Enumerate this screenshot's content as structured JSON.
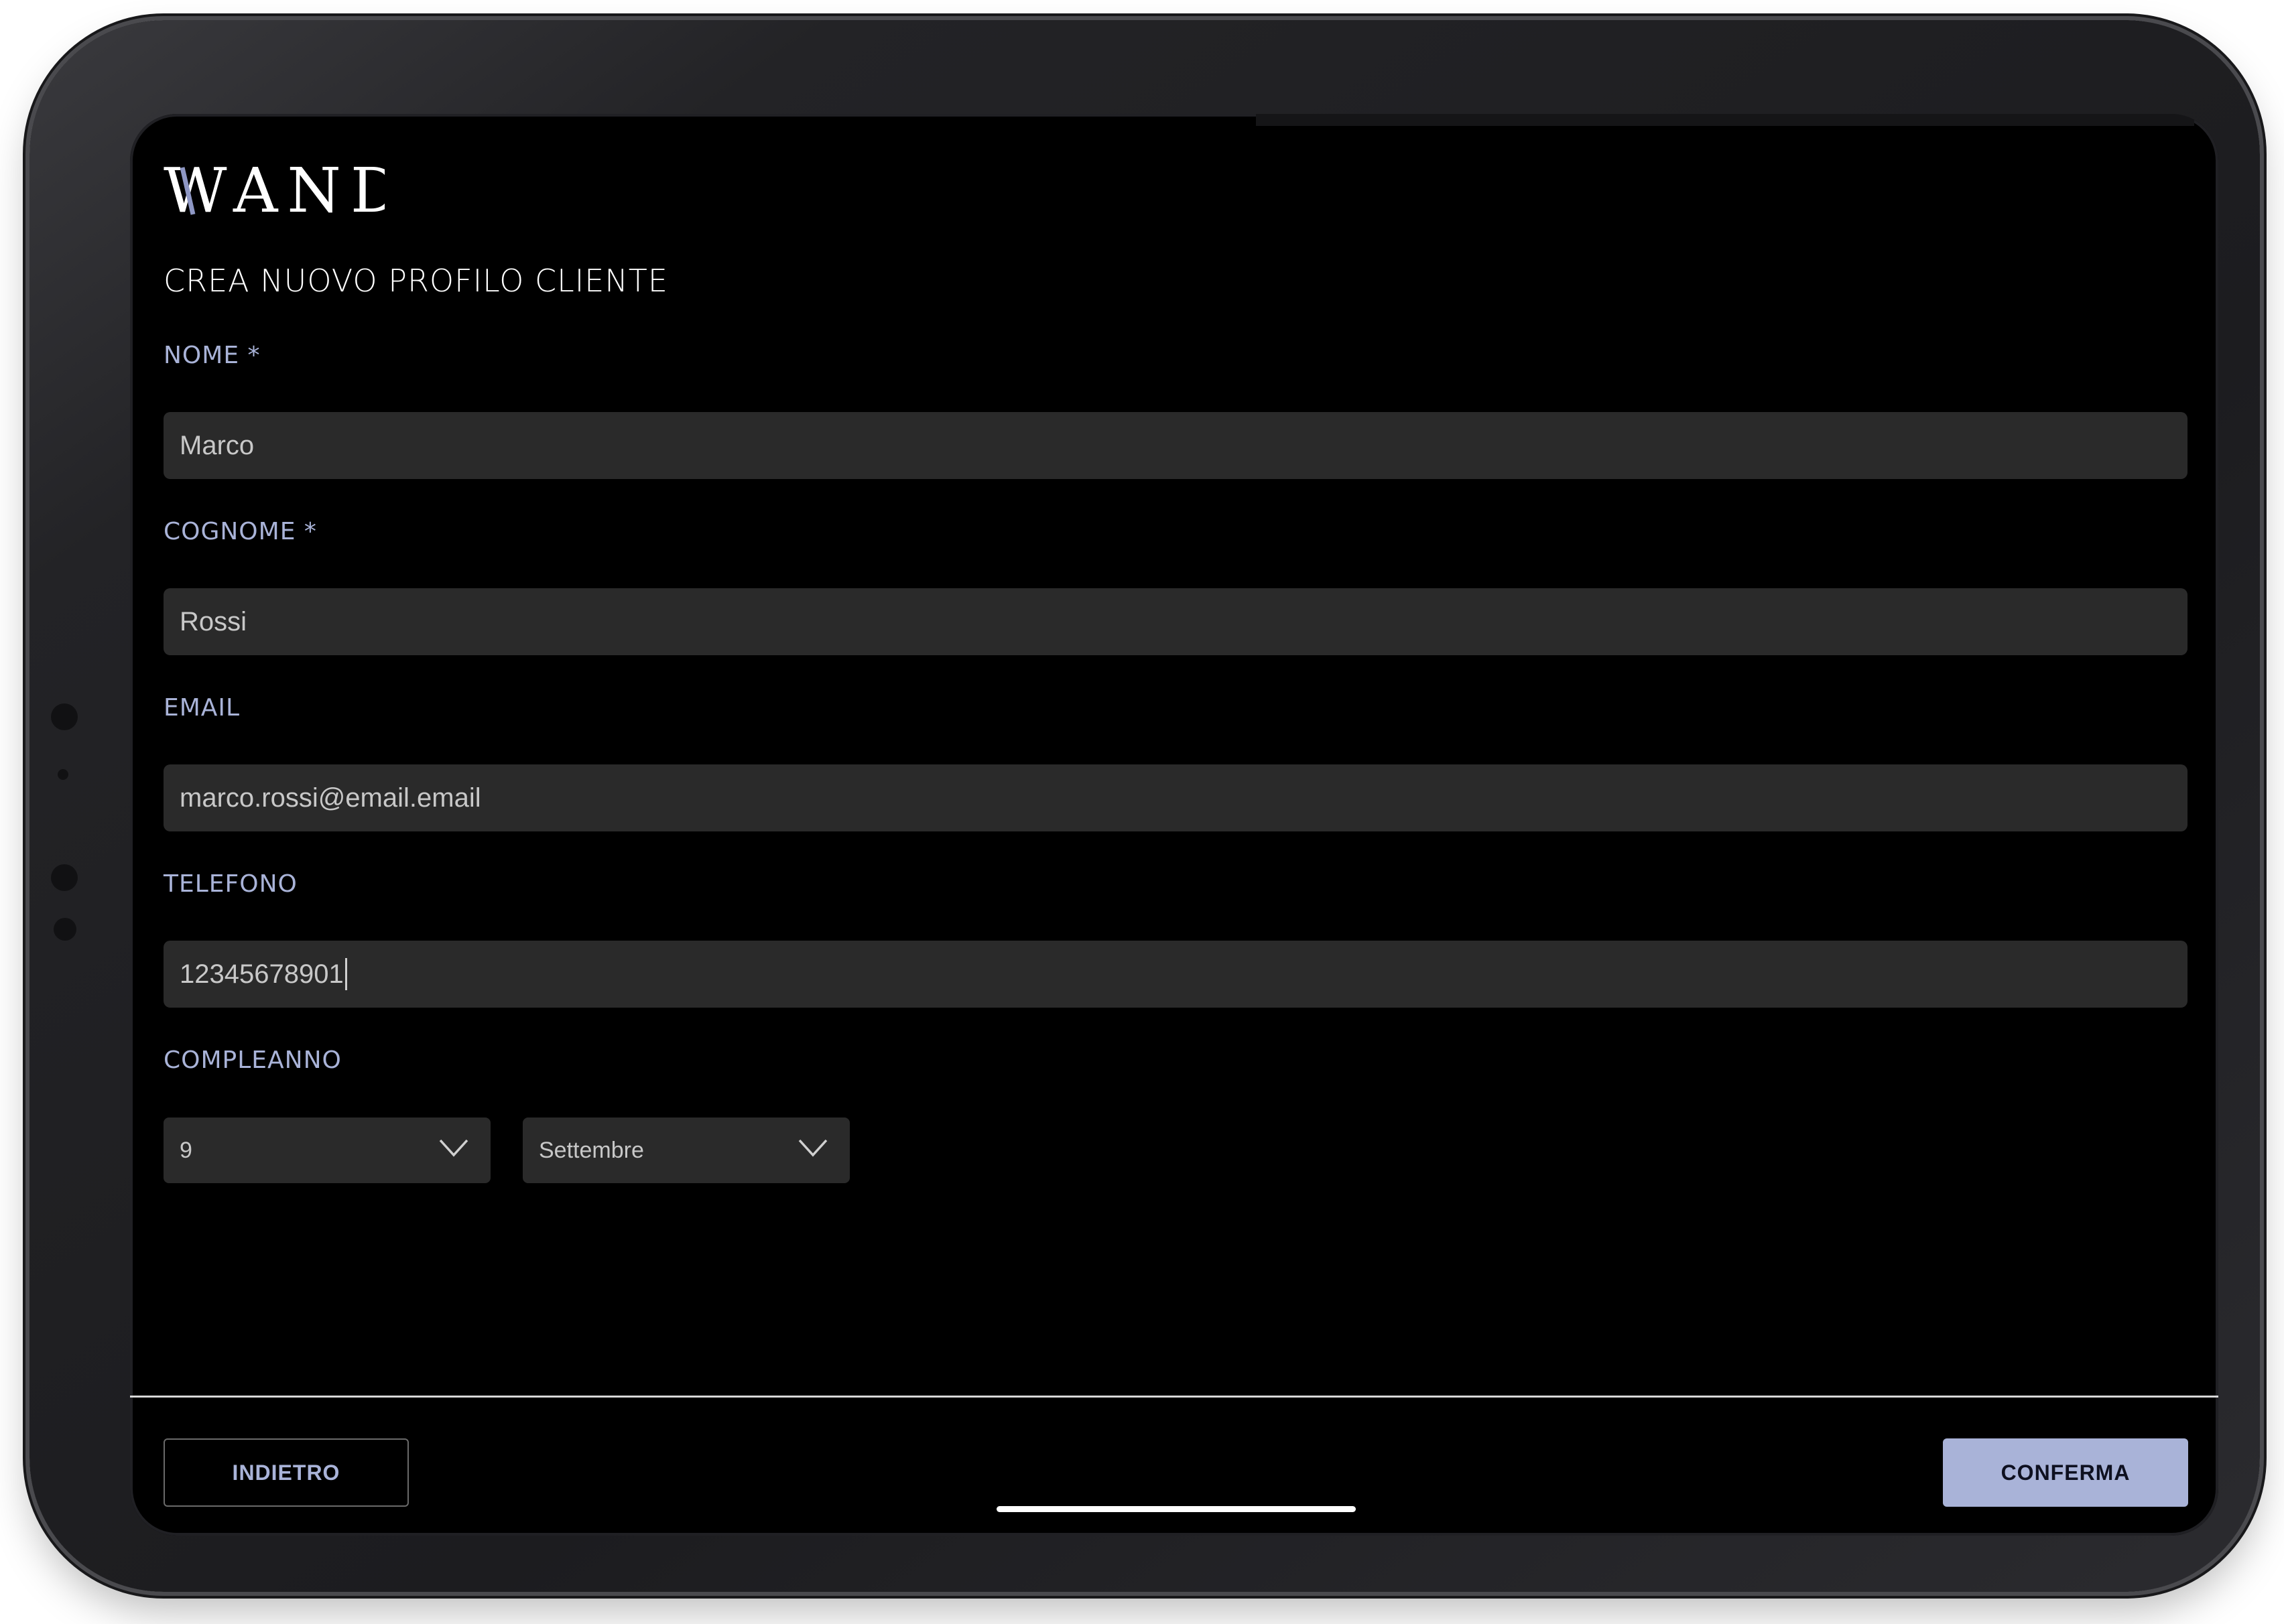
{
  "app": {
    "logo_text": "WAND"
  },
  "form": {
    "title": "CREA NUOVO PROFILO CLIENTE",
    "fields": [
      {
        "label": "NOME *",
        "value": "Marco"
      },
      {
        "label": "COGNOME *",
        "value": "Rossi"
      },
      {
        "label": "EMAIL",
        "value": "marco.rossi@email.email"
      },
      {
        "label": "TELEFONO",
        "value": "12345678901"
      }
    ],
    "birthday": {
      "label": "COMPLEANNO",
      "day": "9",
      "month": "Settembre"
    }
  },
  "footer": {
    "back_label": "INDIETRO",
    "confirm_label": "CONFERMA"
  },
  "colors": {
    "accent": "#a9b3d8",
    "input_bg": "#2a2a2a",
    "screen_bg": "#000000"
  },
  "icons": [
    "wand-logo",
    "chevron-down-icon"
  ]
}
